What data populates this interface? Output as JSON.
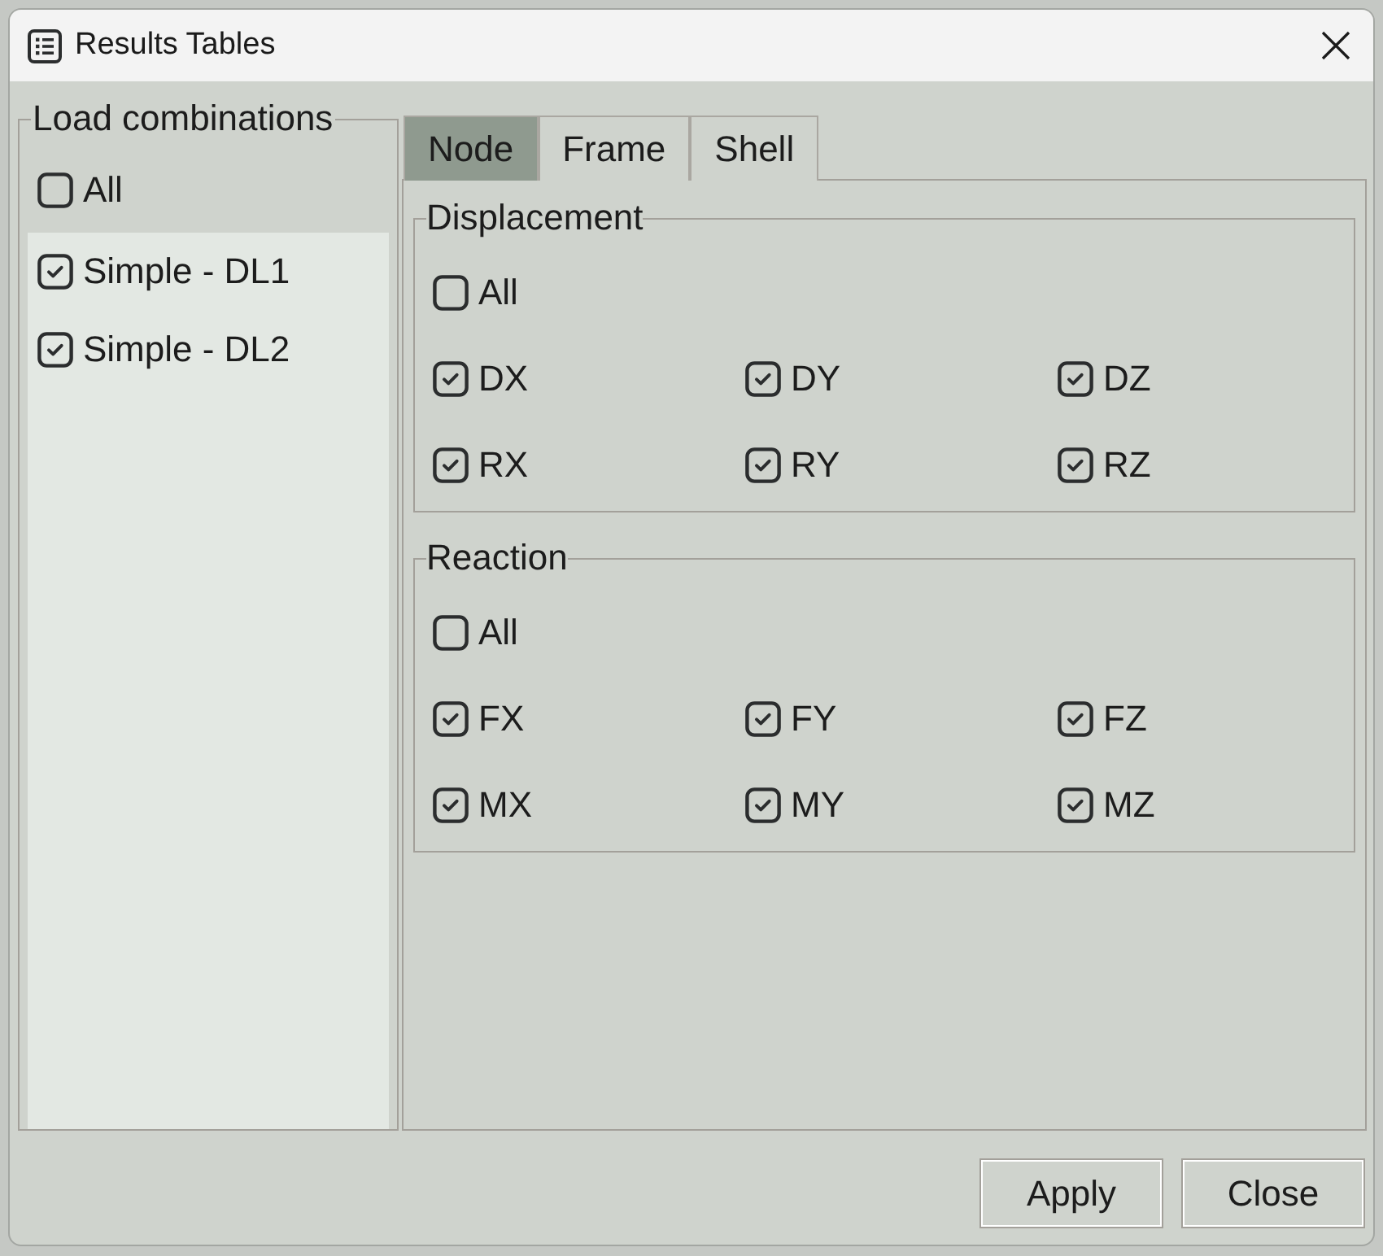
{
  "window": {
    "title": "Results Tables"
  },
  "load_combinations": {
    "title": "Load combinations",
    "all": {
      "label": "All",
      "checked": false
    },
    "items": [
      {
        "label": "Simple - DL1",
        "checked": true
      },
      {
        "label": "Simple - DL2",
        "checked": true
      }
    ]
  },
  "tabs": [
    {
      "label": "Node",
      "selected": true
    },
    {
      "label": "Frame",
      "selected": false
    },
    {
      "label": "Shell",
      "selected": false
    }
  ],
  "groups": [
    {
      "title": "Displacement",
      "all": {
        "label": "All",
        "checked": false
      },
      "options": [
        {
          "label": "DX",
          "checked": true
        },
        {
          "label": "DY",
          "checked": true
        },
        {
          "label": "DZ",
          "checked": true
        },
        {
          "label": "RX",
          "checked": true
        },
        {
          "label": "RY",
          "checked": true
        },
        {
          "label": "RZ",
          "checked": true
        }
      ]
    },
    {
      "title": "Reaction",
      "all": {
        "label": "All",
        "checked": false
      },
      "options": [
        {
          "label": "FX",
          "checked": true
        },
        {
          "label": "FY",
          "checked": true
        },
        {
          "label": "FZ",
          "checked": true
        },
        {
          "label": "MX",
          "checked": true
        },
        {
          "label": "MY",
          "checked": true
        },
        {
          "label": "MZ",
          "checked": true
        }
      ]
    }
  ],
  "buttons": [
    "Apply",
    "Close"
  ]
}
